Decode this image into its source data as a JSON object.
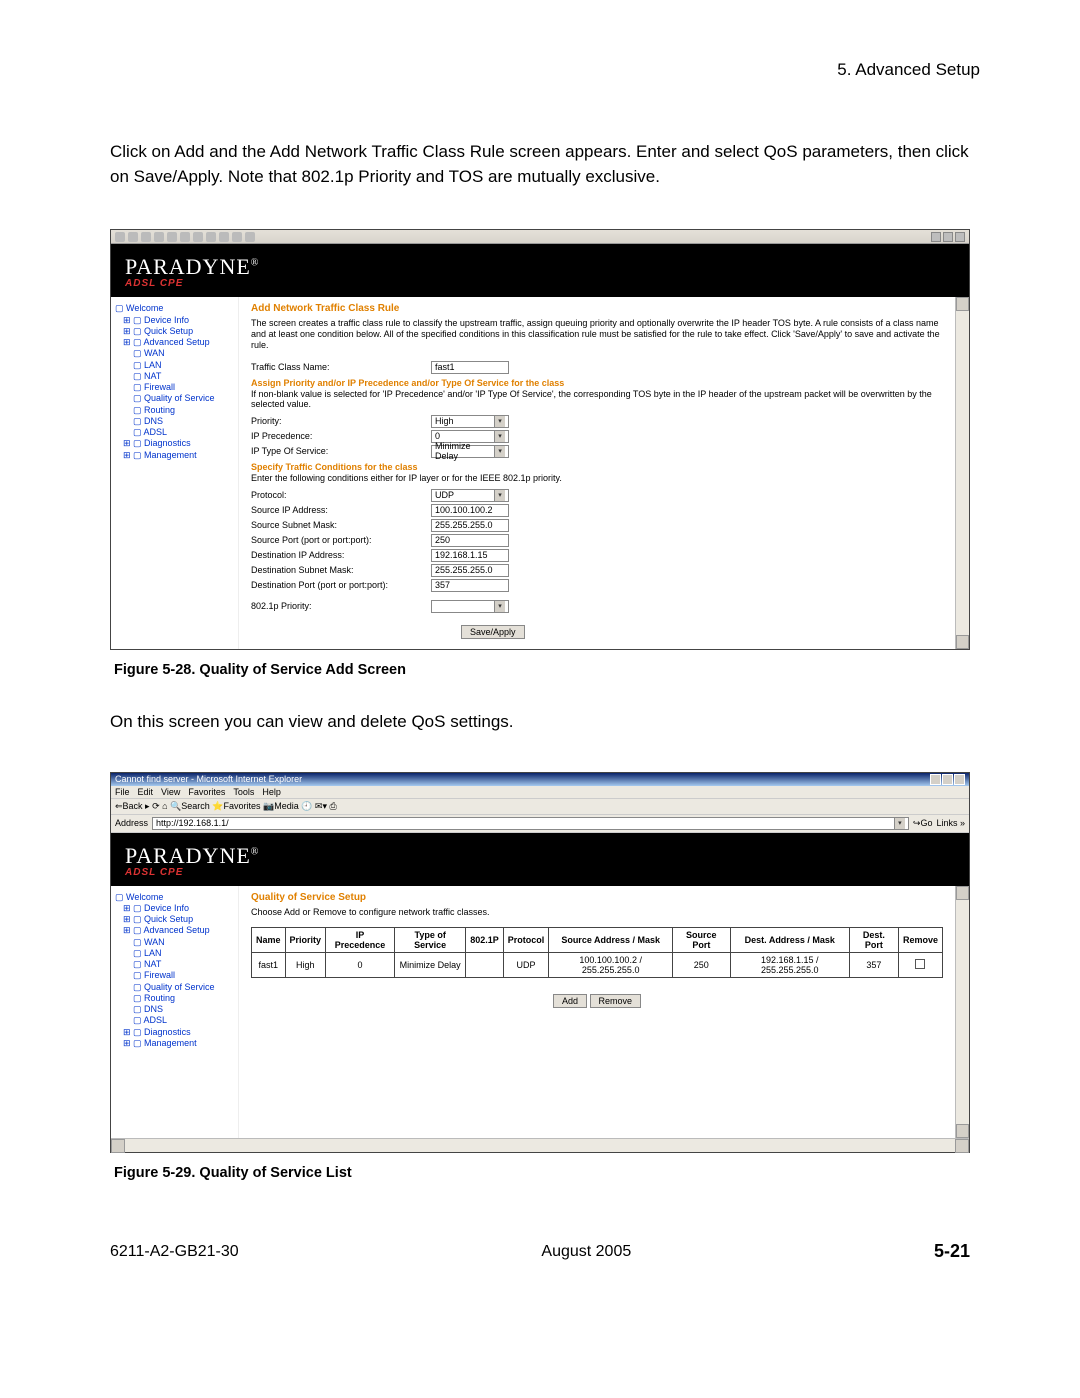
{
  "header": {
    "section": "5. Advanced Setup"
  },
  "intro": "Click on Add and the Add Network Traffic Class Rule screen appears. Enter and select QoS parameters, then click on Save/Apply. Note that 802.1p Priority and TOS are mutually exclusive.",
  "shot1": {
    "logo_main": "PARADYNE",
    "logo_sub": "ADSL CPE",
    "tree": [
      {
        "label": "Welcome",
        "cls": "blue",
        "ind": 0
      },
      {
        "label": "Device Info",
        "cls": "blue",
        "ind": 1
      },
      {
        "label": "Quick Setup",
        "cls": "blue",
        "ind": 1
      },
      {
        "label": "Advanced Setup",
        "cls": "blue",
        "ind": 1
      },
      {
        "label": "WAN",
        "cls": "blue",
        "ind": 2
      },
      {
        "label": "LAN",
        "cls": "blue",
        "ind": 2
      },
      {
        "label": "NAT",
        "cls": "blue",
        "ind": 2
      },
      {
        "label": "Firewall",
        "cls": "blue",
        "ind": 2
      },
      {
        "label": "Quality of Service",
        "cls": "blue",
        "ind": 2
      },
      {
        "label": "Routing",
        "cls": "blue",
        "ind": 2
      },
      {
        "label": "DNS",
        "cls": "blue",
        "ind": 2
      },
      {
        "label": "ADSL",
        "cls": "blue",
        "ind": 2
      },
      {
        "label": "Diagnostics",
        "cls": "blue",
        "ind": 1
      },
      {
        "label": "Management",
        "cls": "blue",
        "ind": 1
      }
    ],
    "title": "Add Network Traffic Class Rule",
    "desc": "The screen creates a traffic class rule to classify the upstream traffic, assign queuing priority and optionally overwrite the IP header TOS byte. A rule consists of a class name and at least one condition below. All of the specified conditions in this classification rule must be satisfied for the rule to take effect. Click 'Save/Apply' to save and activate the rule.",
    "fields": {
      "traffic_class_name_label": "Traffic Class Name:",
      "traffic_class_name_value": "fast1",
      "assign_header": "Assign Priority and/or IP Precedence and/or Type Of Service for the class",
      "assign_note": "If non-blank value is selected for 'IP Precedence' and/or 'IP Type Of Service', the corresponding TOS byte in the IP header of the upstream packet will be overwritten by the selected value.",
      "priority_label": "Priority:",
      "priority_value": "High",
      "ip_prec_label": "IP Precedence:",
      "ip_prec_value": "0",
      "ip_tos_label": "IP Type Of Service:",
      "ip_tos_value": "Minimize Delay",
      "cond_header": "Specify Traffic Conditions for the class",
      "cond_note": "Enter the following conditions either for IP layer or for the IEEE 802.1p priority.",
      "protocol_label": "Protocol:",
      "protocol_value": "UDP",
      "src_ip_label": "Source IP Address:",
      "src_ip_value": "100.100.100.2",
      "src_mask_label": "Source Subnet Mask:",
      "src_mask_value": "255.255.255.0",
      "src_port_label": "Source Port (port or port:port):",
      "src_port_value": "250",
      "dst_ip_label": "Destination IP Address:",
      "dst_ip_value": "192.168.1.15",
      "dst_mask_label": "Destination Subnet Mask:",
      "dst_mask_value": "255.255.255.0",
      "dst_port_label": "Destination Port (port or port:port):",
      "dst_port_value": "357",
      "p8021_label": "802.1p Priority:",
      "p8021_value": "",
      "save_btn": "Save/Apply"
    }
  },
  "caption1": "Figure 5-28.   Quality of Service Add Screen",
  "mid": "On this screen you can view and delete QoS settings.",
  "shot2": {
    "ie_title": "Cannot find server - Microsoft Internet Explorer",
    "ie_menu": [
      "File",
      "Edit",
      "View",
      "Favorites",
      "Tools",
      "Help"
    ],
    "ie_btns": "⇐Back  ▸  ⟳  ⌂  🔍Search  ⭐Favorites  📷Media  🕘  ✉▾ ⎙",
    "addr_label": "Address",
    "addr_value": "http://192.168.1.1/",
    "go": "↪Go",
    "links": "Links »",
    "logo_main": "PARADYNE",
    "logo_sub": "ADSL CPE",
    "tree": [
      {
        "label": "Welcome",
        "cls": "blue",
        "ind": 0
      },
      {
        "label": "Device Info",
        "cls": "blue",
        "ind": 1
      },
      {
        "label": "Quick Setup",
        "cls": "blue",
        "ind": 1
      },
      {
        "label": "Advanced Setup",
        "cls": "blue",
        "ind": 1
      },
      {
        "label": "WAN",
        "cls": "blue",
        "ind": 2
      },
      {
        "label": "LAN",
        "cls": "blue",
        "ind": 2
      },
      {
        "label": "NAT",
        "cls": "blue",
        "ind": 2
      },
      {
        "label": "Firewall",
        "cls": "blue",
        "ind": 2
      },
      {
        "label": "Quality of Service",
        "cls": "blue",
        "ind": 2
      },
      {
        "label": "Routing",
        "cls": "blue",
        "ind": 2
      },
      {
        "label": "DNS",
        "cls": "blue",
        "ind": 2
      },
      {
        "label": "ADSL",
        "cls": "blue",
        "ind": 2
      },
      {
        "label": "Diagnostics",
        "cls": "blue",
        "ind": 1
      },
      {
        "label": "Management",
        "cls": "blue",
        "ind": 1
      }
    ],
    "title": "Quality of Service Setup",
    "desc": "Choose Add or Remove to configure network traffic classes.",
    "table": {
      "headers": [
        "Name",
        "Priority",
        "IP Precedence",
        "Type of Service",
        "802.1P",
        "Protocol",
        "Source Address / Mask",
        "Source Port",
        "Dest. Address / Mask",
        "Dest. Port",
        "Remove"
      ],
      "row": [
        "fast1",
        "High",
        "0",
        "Minimize Delay",
        "",
        "UDP",
        "100.100.100.2 / 255.255.255.0",
        "250",
        "192.168.1.15 / 255.255.255.0",
        "357",
        ""
      ]
    },
    "add_btn": "Add",
    "remove_btn": "Remove"
  },
  "caption2": "Figure 5-29.   Quality of Service List",
  "footer": {
    "left": "6211-A2-GB21-30",
    "center": "August 2005",
    "right": "5-21"
  }
}
